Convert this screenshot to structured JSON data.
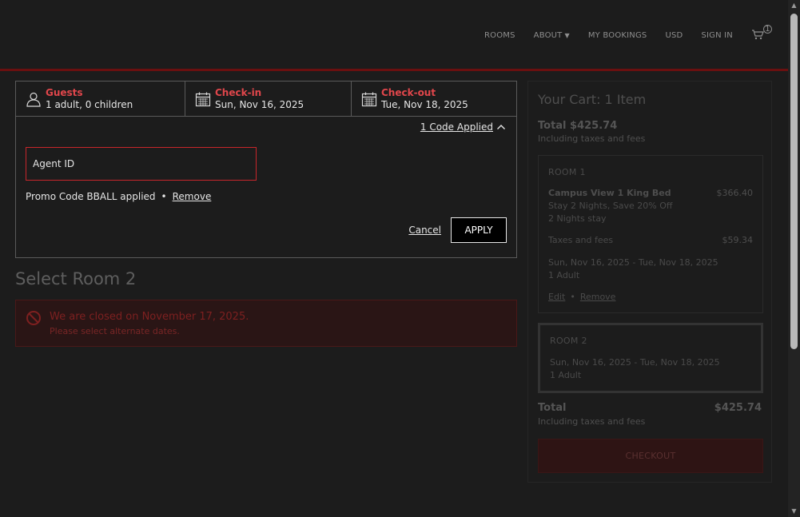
{
  "nav": {
    "rooms": "ROOMS",
    "about": "ABOUT",
    "my_bookings": "MY BOOKINGS",
    "currency": "USD",
    "sign_in": "SIGN IN",
    "cart_count": "1"
  },
  "search": {
    "guests_title": "Guests",
    "guests_value": "1 adult, 0 children",
    "checkin_title": "Check-in",
    "checkin_value": "Sun, Nov 16, 2025",
    "checkout_title": "Check-out",
    "checkout_value": "Tue, Nov 18, 2025",
    "codes_link": "1 Code Applied",
    "agent_placeholder": "Agent ID",
    "promo_text": "Promo Code BBALL applied",
    "promo_remove": "Remove",
    "cancel": "Cancel",
    "apply": "APPLY"
  },
  "main": {
    "select_title": "Select Room 2",
    "alert_message": "We are closed on November 17, 2025.",
    "alert_sub": "Please select alternate dates."
  },
  "cart": {
    "title": "Your Cart: 1 Item",
    "total_top": "Total $425.74",
    "total_top_sub": "Including taxes and fees",
    "room1": {
      "label": "ROOM 1",
      "name": "Campus View 1 King Bed",
      "price": "$366.40",
      "rate": "Stay 2 Nights, Save 20% Off",
      "nights": "2 Nights stay",
      "taxes_label": "Taxes and fees",
      "taxes_value": "$59.34",
      "dates": "Sun, Nov 16, 2025 - Tue, Nov 18, 2025",
      "occupancy": "1 Adult",
      "edit": "Edit",
      "remove": "Remove"
    },
    "room2": {
      "label": "ROOM 2",
      "dates": "Sun, Nov 16, 2025 - Tue, Nov 18, 2025",
      "occupancy": "1 Adult"
    },
    "total_label": "Total",
    "total_value": "$425.74",
    "total_sub": "Including taxes and fees",
    "checkout": "CHECKOUT"
  },
  "colors": {
    "accent": "#e0464b",
    "header_rule": "#6a1010",
    "background": "#1c1c1c"
  }
}
